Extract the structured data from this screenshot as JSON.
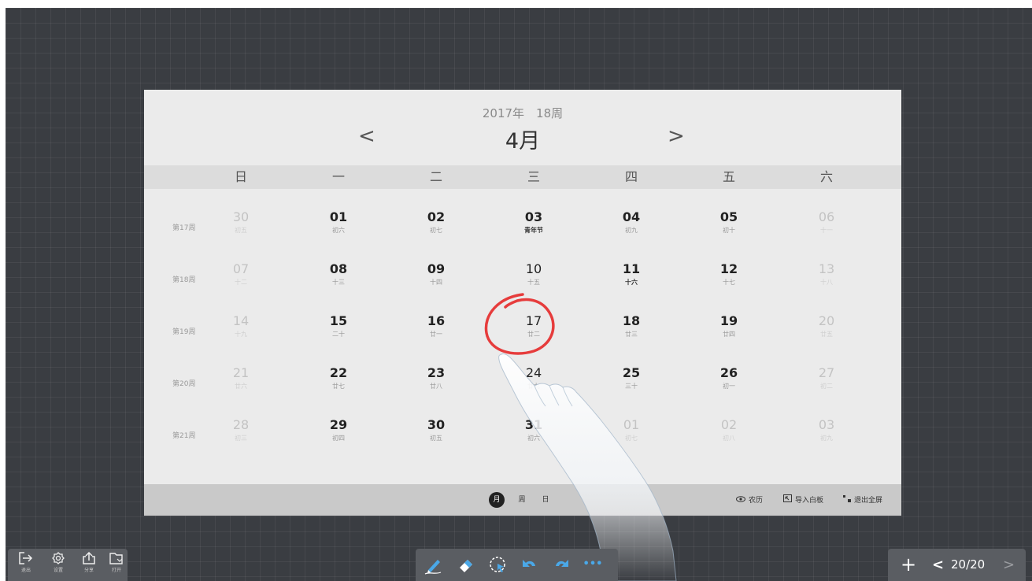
{
  "calendar": {
    "year_week": "2017年　18周",
    "month": "4月",
    "prev_arrow": "<",
    "next_arrow": ">",
    "weekdays": [
      "日",
      "一",
      "二",
      "三",
      "四",
      "五",
      "六"
    ],
    "weeks": [
      {
        "label": "第17周",
        "days": [
          {
            "num": "30",
            "lunar": "初五",
            "style": "muted"
          },
          {
            "num": "01",
            "lunar": "初六",
            "style": ""
          },
          {
            "num": "02",
            "lunar": "初七",
            "style": ""
          },
          {
            "num": "03",
            "lunar": "青年节",
            "style": "festival"
          },
          {
            "num": "04",
            "lunar": "初九",
            "style": ""
          },
          {
            "num": "05",
            "lunar": "初十",
            "style": ""
          },
          {
            "num": "06",
            "lunar": "十一",
            "style": "muted"
          }
        ]
      },
      {
        "label": "第18周",
        "days": [
          {
            "num": "07",
            "lunar": "十二",
            "style": "muted"
          },
          {
            "num": "08",
            "lunar": "十三",
            "style": ""
          },
          {
            "num": "09",
            "lunar": "十四",
            "style": ""
          },
          {
            "num": "10",
            "lunar": "十五",
            "style": "light"
          },
          {
            "num": "11",
            "lunar": "十六",
            "style": "bold-lunar"
          },
          {
            "num": "12",
            "lunar": "十七",
            "style": ""
          },
          {
            "num": "13",
            "lunar": "十八",
            "style": "muted"
          }
        ]
      },
      {
        "label": "第19周",
        "days": [
          {
            "num": "14",
            "lunar": "十九",
            "style": "muted"
          },
          {
            "num": "15",
            "lunar": "二十",
            "style": ""
          },
          {
            "num": "16",
            "lunar": "廿一",
            "style": ""
          },
          {
            "num": "17",
            "lunar": "廿二",
            "style": "light"
          },
          {
            "num": "18",
            "lunar": "廿三",
            "style": ""
          },
          {
            "num": "19",
            "lunar": "廿四",
            "style": ""
          },
          {
            "num": "20",
            "lunar": "廿五",
            "style": "muted"
          }
        ]
      },
      {
        "label": "第20周",
        "days": [
          {
            "num": "21",
            "lunar": "廿六",
            "style": "muted"
          },
          {
            "num": "22",
            "lunar": "廿七",
            "style": ""
          },
          {
            "num": "23",
            "lunar": "廿八",
            "style": ""
          },
          {
            "num": "24",
            "lunar": "廿九",
            "style": "light"
          },
          {
            "num": "25",
            "lunar": "三十",
            "style": ""
          },
          {
            "num": "26",
            "lunar": "初一",
            "style": ""
          },
          {
            "num": "27",
            "lunar": "初二",
            "style": "muted"
          }
        ]
      },
      {
        "label": "第21周",
        "days": [
          {
            "num": "28",
            "lunar": "初三",
            "style": "muted"
          },
          {
            "num": "29",
            "lunar": "初四",
            "style": ""
          },
          {
            "num": "30",
            "lunar": "初五",
            "style": ""
          },
          {
            "num": "31",
            "lunar": "初六",
            "style": ""
          },
          {
            "num": "01",
            "lunar": "初七",
            "style": "muted"
          },
          {
            "num": "02",
            "lunar": "初八",
            "style": "muted"
          },
          {
            "num": "03",
            "lunar": "初九",
            "style": "muted"
          }
        ]
      }
    ],
    "footer": {
      "views": [
        "月",
        "周",
        "日"
      ],
      "active_view": "月",
      "lunar_toggle": "农历",
      "import_whiteboard": "导入白板",
      "exit_fullscreen": "退出全屏"
    }
  },
  "toolbar_left": {
    "exit_label": "退出",
    "settings_label": "设置",
    "share_label": "分享",
    "open_label": "打开"
  },
  "toolbar_mid": {
    "tools": [
      "pen-icon",
      "eraser-icon",
      "lasso-select-icon",
      "undo-icon",
      "redo-icon",
      "more-icon"
    ],
    "more_glyph": "•••"
  },
  "toolbar_right": {
    "add_glyph": "+",
    "prev_glyph": "<",
    "page_indicator": "20/20",
    "next_glyph": ">"
  },
  "colors": {
    "board_bg": "#3a3d42",
    "calendar_bg": "#ebebeb",
    "annotation_red": "#e63c3c",
    "toolbar_bg": "#5a5d62",
    "pen_blue": "#4aa8e8"
  }
}
